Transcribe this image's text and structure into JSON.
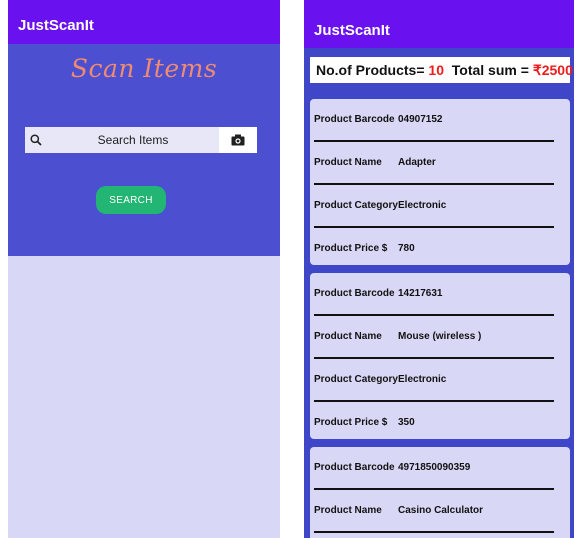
{
  "left": {
    "app_title": "JustScanIt",
    "hero_title": "Scan Items",
    "search_placeholder": "Search Items",
    "search_button": "SEARCH"
  },
  "right": {
    "app_title": "JustScanIt",
    "summary": {
      "count_label": "No.of Products=",
      "count_value": "10",
      "sum_label": "Total sum =",
      "sum_value": "₹2500"
    },
    "labels": {
      "barcode": "Product Barcode",
      "name": "Product Name",
      "category": "Product Category",
      "price": "Product Price $"
    },
    "products": [
      {
        "barcode": "04907152",
        "name": "Adapter",
        "category": "Electronic",
        "price": "780"
      },
      {
        "barcode": "14217631",
        "name": "Mouse (wireless )",
        "category": "Electronic",
        "price": "350"
      },
      {
        "barcode": "4971850090359",
        "name": "Casino Calculator"
      }
    ]
  },
  "colors": {
    "appbar": "#6a11f0",
    "hero": "#4b4fd0",
    "background": "#d8d8f6",
    "accent_green": "#22b573",
    "title_orange": "#f08b6f",
    "highlight_red": "#ee1c1c"
  }
}
